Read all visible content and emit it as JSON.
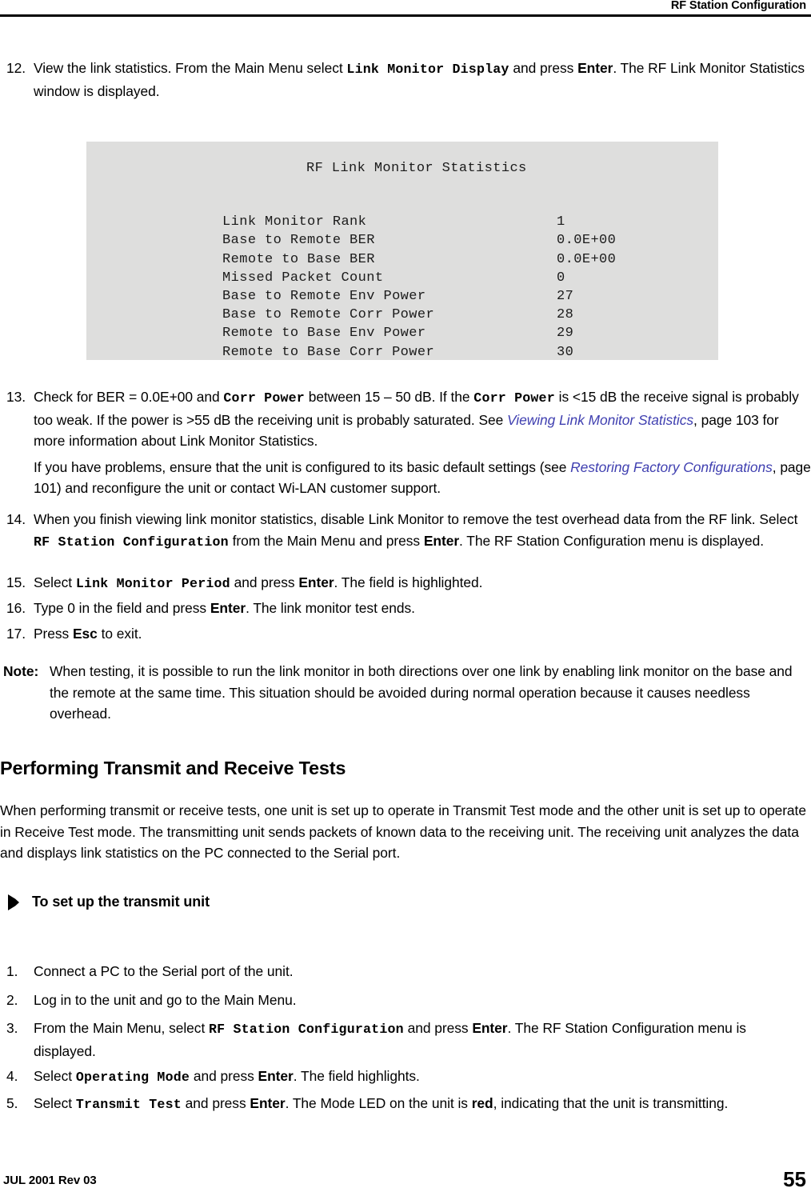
{
  "header": {
    "title": "RF Station Configuration"
  },
  "footer": {
    "revision": "JUL 2001 Rev 03",
    "page_number": "55"
  },
  "colors": {
    "cross_reference": "#3f3fb0",
    "terminal_background": "#dededd",
    "text": "#000000"
  },
  "step12": {
    "number": "12.",
    "part1": "View the link statistics. From the Main Menu select ",
    "mono1": "Link Monitor Display",
    "part2": " and press ",
    "bold1": "Enter",
    "part3": ". The RF Link Monitor Statistics window is displayed."
  },
  "terminal": {
    "title": "RF Link Monitor Statistics",
    "rows": [
      {
        "label": "Link Monitor Rank",
        "value": "1"
      },
      {
        "label": "Base to Remote BER",
        "value": "0.0E+00"
      },
      {
        "label": "Remote to Base BER",
        "value": "0.0E+00"
      },
      {
        "label": "Missed Packet Count",
        "value": "0"
      },
      {
        "label": "Base to Remote Env Power",
        "value": "27"
      },
      {
        "label": "Base to Remote Corr Power",
        "value": "28"
      },
      {
        "label": "Remote to Base Env Power",
        "value": "29"
      },
      {
        "label": "Remote to Base Corr Power",
        "value": "30"
      }
    ]
  },
  "step13": {
    "number": "13.",
    "part1": "Check for BER = 0.0E+00 and ",
    "mono1": "Corr Power",
    "part2": " between 15 – 50 dB. If the ",
    "mono2": "Corr Power",
    "part3": " is <15 dB the receive signal is probably too weak. If the power is >55 dB the receiving unit is probably saturated. See ",
    "xref1": "Viewing Link Monitor Statistics",
    "part4": ", page 103 for more information about Link Monitor Statistics.",
    "sub_part1": "If you have problems, ensure that the unit is configured to its basic default settings (see ",
    "sub_xref": "Restoring Factory Configurations",
    "sub_part2": ", page 101) and reconfigure the unit or contact Wi-LAN customer support."
  },
  "step14": {
    "number": "14.",
    "part1": "When you finish viewing link monitor statistics, disable Link Monitor to remove the test overhead data from the RF link. Select ",
    "mono1": "RF Station Configuration",
    "part2": " from the Main Menu and press ",
    "bold1": "Enter",
    "part3": ". The RF Station Configuration menu is displayed."
  },
  "step15": {
    "number": "15.",
    "part1": "Select ",
    "mono1": "Link Monitor Period",
    "part2": " and press ",
    "bold1": "Enter",
    "part3": ". The field is highlighted."
  },
  "step16": {
    "number": "16.",
    "part1": "Type 0 in the field and press ",
    "bold1": "Enter",
    "part2": ". The link monitor test ends."
  },
  "step17": {
    "number": "17.",
    "part1": "Press ",
    "bold1": "Esc",
    "part2": " to exit."
  },
  "note": {
    "label": "Note:",
    "text": "When testing, it is possible to run the link monitor in both directions over one link by enabling link monitor on the base and the remote at the same time. This situation should be avoided during normal operation because it causes needless overhead."
  },
  "section": {
    "heading": "Performing Transmit and Receive Tests",
    "body": "When performing transmit or receive tests, one unit is set up to operate in Transmit Test mode and the other unit is set up to operate in Receive Test mode. The transmitting unit sends packets of known data to the receiving unit. The receiving unit analyzes the data and displays link statistics on the PC connected to the Serial port."
  },
  "procedure": {
    "heading": "To set up the transmit unit",
    "steps": [
      {
        "number": "1.",
        "part1": "Connect a PC to the Serial port of the unit."
      },
      {
        "number": "2.",
        "part1": "Log in to the unit and go to the Main Menu."
      },
      {
        "number": "3.",
        "part1": "From the Main Menu, select ",
        "mono1": "RF Station Configuration",
        "part2": " and press ",
        "bold1": "Enter",
        "part3": ". The RF Station Configuration menu is displayed."
      },
      {
        "number": "4.",
        "part1": "Select ",
        "mono1": "Operating Mode",
        "part2": " and press ",
        "bold1": "Enter",
        "part3": ". The field highlights."
      },
      {
        "number": "5.",
        "part1": "Select ",
        "mono1": "Transmit Test",
        "part2": " and press ",
        "bold1": "Enter",
        "part3": ". The Mode LED on the unit is ",
        "bold2": "red",
        "part4": ", indicating that the unit is transmitting."
      }
    ]
  }
}
